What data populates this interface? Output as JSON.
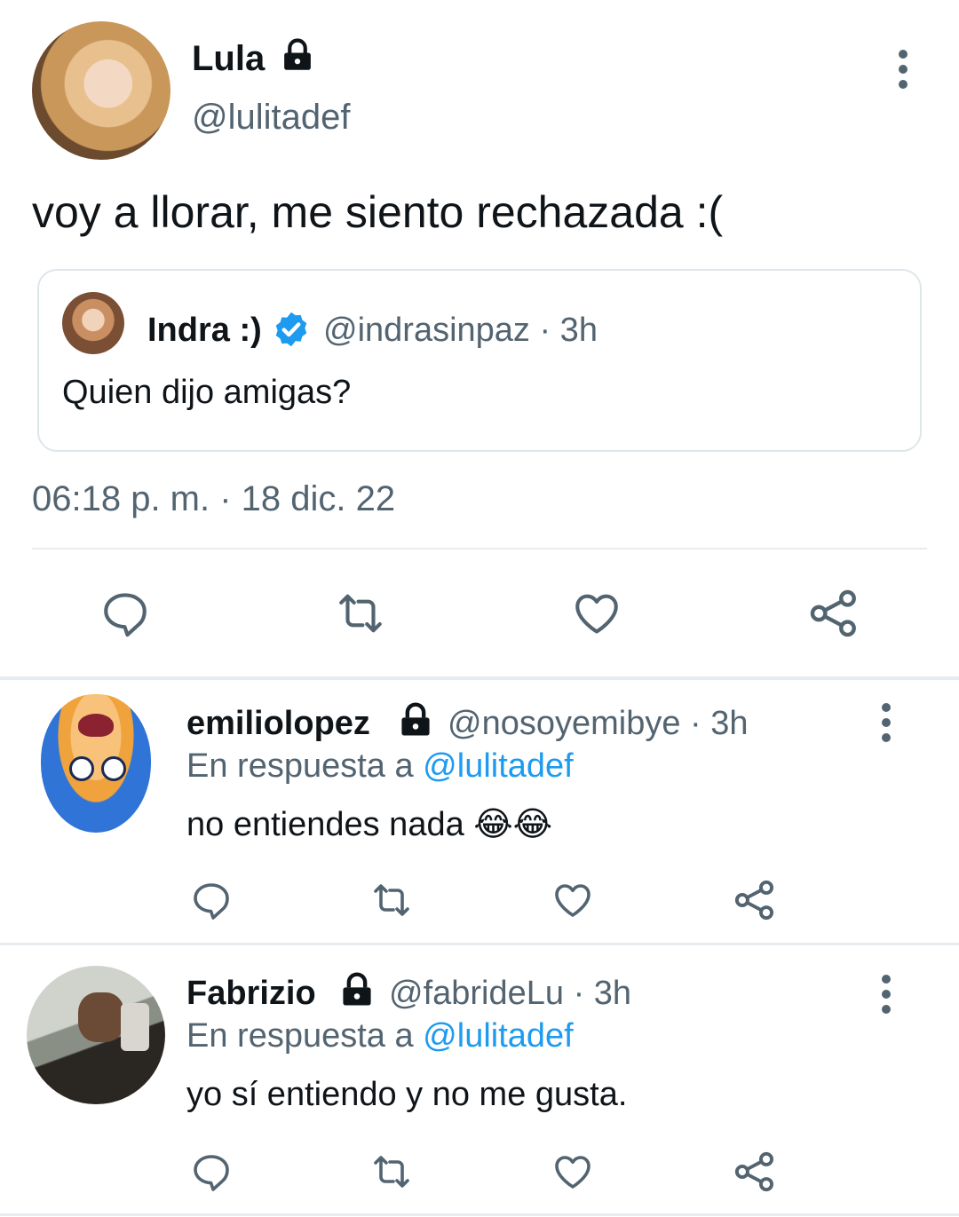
{
  "main_tweet": {
    "name": "Lula",
    "handle": "@lulitadef",
    "text": "voy a llorar, me siento rechazada :(",
    "timestamp": "06:18 p. m. · 18 dic. 22",
    "protected": true
  },
  "quoted_tweet": {
    "name": "Indra :)",
    "handle_time": "@indrasinpaz · 3h",
    "text": "Quien dijo amigas?",
    "verified": true
  },
  "replies": [
    {
      "name": "emiliolopez",
      "handle_time": "@nosoyemibye · 3h",
      "reply_prefix": "En respuesta a",
      "reply_to": "@lulitadef",
      "text": "no entiendes nada 😂😂",
      "protected": true
    },
    {
      "name": "Fabrizio",
      "handle_time": "@fabrideLu · 3h",
      "reply_prefix": "En respuesta a",
      "reply_to": "@lulitadef",
      "text": "yo sí entiendo y no me gusta.",
      "protected": true
    }
  ],
  "icons": [
    "lock-icon",
    "verified-badge-icon",
    "more-options-icon",
    "reply-icon",
    "retweet-icon",
    "like-icon",
    "share-icon"
  ],
  "colors": {
    "text": "#0f1419",
    "muted": "#536471",
    "link": "#1d9bf0",
    "divider": "#e6ecf0"
  }
}
